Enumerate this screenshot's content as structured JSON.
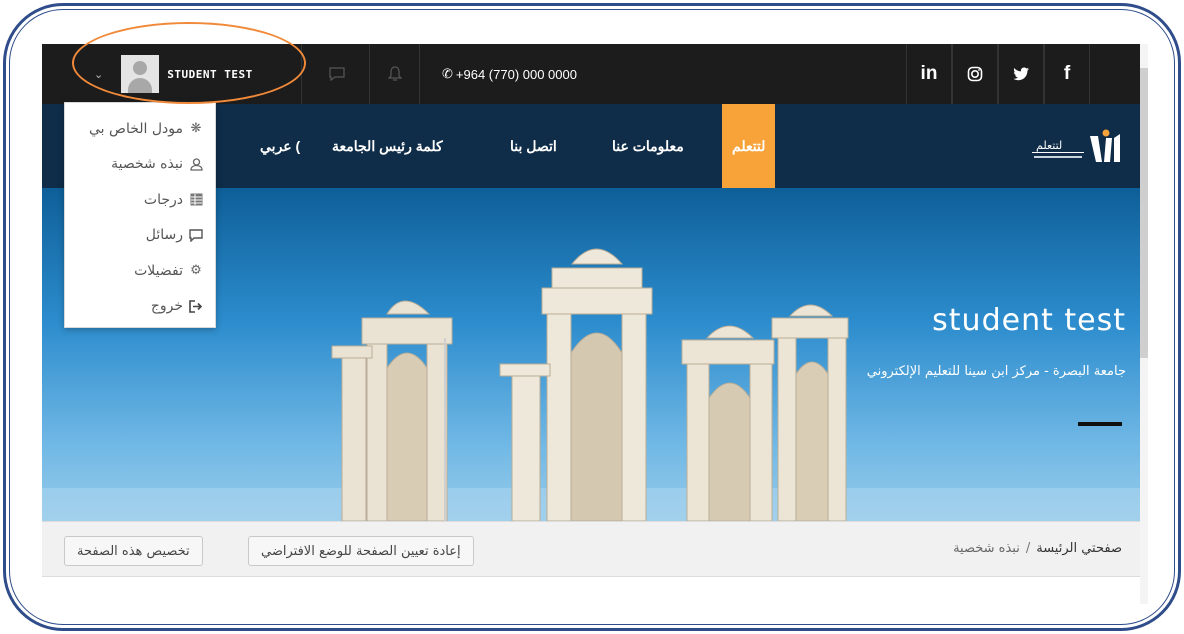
{
  "topbar": {
    "username": "STUDENT TEST",
    "phone": "+964 (770) 000 0000",
    "social": [
      "in",
      "◎",
      "🐦",
      "f"
    ]
  },
  "nav": {
    "learn": "لتتعلم",
    "about": "معلومات عنا",
    "contact": "اتصل بنا",
    "president": "كلمة رئيس الجامعة",
    "language": "عربي ("
  },
  "dropdown": {
    "items": [
      "مودل الخاص بي",
      "نبذه شخصية",
      "درجات",
      "رسائل",
      "تفضيلات",
      "خروج"
    ]
  },
  "hero": {
    "title": "student test",
    "subtitle": "جامعة البصرة - مركز ابن سينا للتعليم الإلكتروني"
  },
  "breadcrumb": {
    "home": "صفحتي الرئيسة",
    "separator": "/",
    "current": "نبذه شخصية"
  },
  "buttons": {
    "reset": "إعادة تعيين الصفحة للوضع الافتراضي",
    "customize": "تخصيص هذه الصفحة"
  },
  "colors": {
    "topbar": "#1c1c1c",
    "navbar": "#0f2c48",
    "accent": "#f7a33a",
    "frame": "#2f4d8a",
    "highlight": "#f08a3a"
  }
}
